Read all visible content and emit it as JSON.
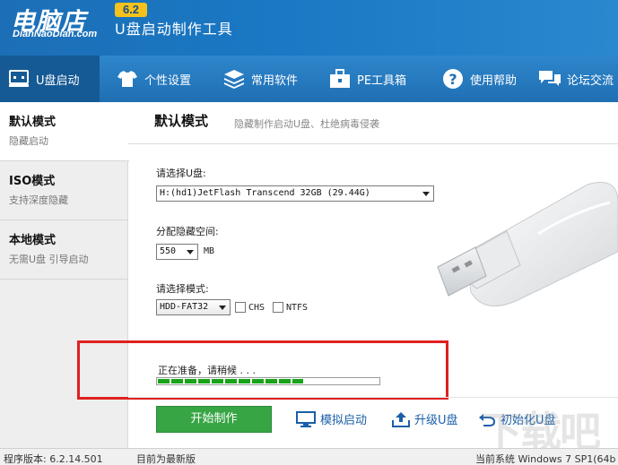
{
  "app": {
    "logo_text": "电脑店",
    "logo_sub": "DianNaoDian.com",
    "version_badge": "6.2",
    "title": "U盘启动制作工具"
  },
  "nav": {
    "items": [
      {
        "label": "U盘启动",
        "icon": "usb-drive-icon",
        "active": true
      },
      {
        "label": "个性设置",
        "icon": "tshirt-icon"
      },
      {
        "label": "常用软件",
        "icon": "layers-icon"
      },
      {
        "label": "PE工具箱",
        "icon": "toolbox-icon"
      },
      {
        "label": "使用帮助",
        "icon": "help-icon"
      },
      {
        "label": "论坛交流",
        "icon": "chat-icon"
      }
    ]
  },
  "sidebar": {
    "items": [
      {
        "title": "默认模式",
        "subtitle": "隐藏启动"
      },
      {
        "title": "ISO模式",
        "subtitle": "支持深度隐藏"
      },
      {
        "title": "本地模式",
        "subtitle": "无需U盘 引导启动"
      }
    ]
  },
  "main": {
    "title": "默认模式",
    "subtitle": "隐藏制作启动U盘、杜绝病毒侵袭",
    "select_disk_label": "请选择U盘:",
    "select_disk_value": "H:(hd1)JetFlash Transcend 32GB (29.44G)",
    "hidden_space_label": "分配隐藏空间:",
    "hidden_space_value": "550",
    "hidden_space_unit": "MB",
    "mode_label": "请选择模式:",
    "mode_value": "HDD-FAT32",
    "fs_options": [
      "CHS",
      "NTFS"
    ]
  },
  "progress": {
    "status_text": "正在准备，请稍候 . . .",
    "percent": 66
  },
  "actions": {
    "start_label": "开始制作",
    "simulate_label": "模拟启动",
    "upgrade_label": "升级U盘",
    "init_label": "初始化U盘"
  },
  "statusbar": {
    "version_text": "程序版本: 6.2.14.501",
    "update_text": "目前为最新版",
    "os_text": "当前系统 Windows 7 SP1(64b"
  },
  "watermark": "下载吧",
  "colors": {
    "header_blue": "#1a78c4",
    "nav_active": "#155a94",
    "progress_green": "#19a319",
    "start_button": "#37a544",
    "highlight_red": "#e02020",
    "link_blue": "#1a5fa8"
  }
}
